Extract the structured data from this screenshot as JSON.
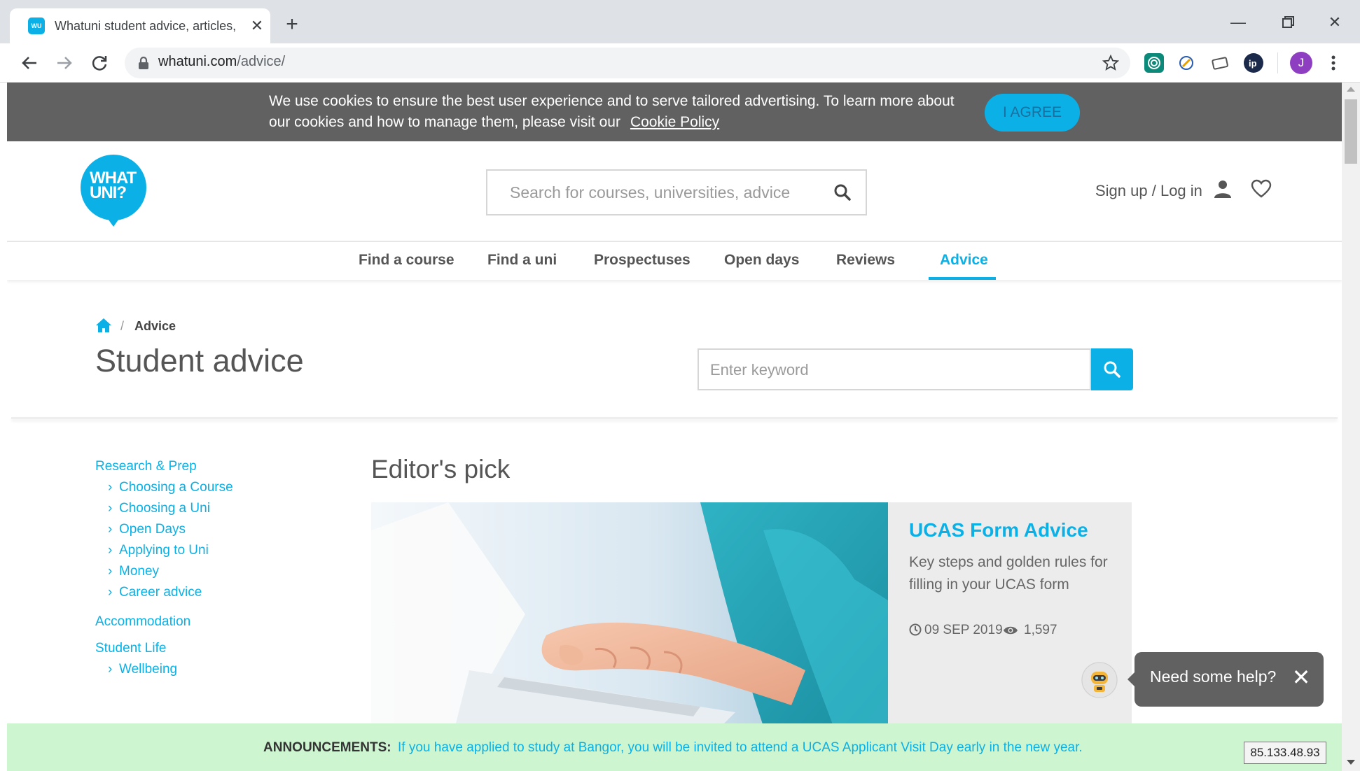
{
  "browser": {
    "tab_title": "Whatuni student advice, articles,",
    "tab_favicon": "WU",
    "url_host": "whatuni.com",
    "url_path": "/advice/",
    "profile_initial": "J"
  },
  "cookie": {
    "text": "We use cookies to ensure the best user experience and to serve tailored advertising. To learn more about our cookies and how to manage them, please visit our",
    "link": "Cookie Policy",
    "agree": "I AGREE"
  },
  "header": {
    "logo_line1": "WHAT",
    "logo_line2": "UNI?",
    "search_placeholder": "Search for courses, universities, advice",
    "signup": "Sign up / Log in"
  },
  "nav": {
    "items": [
      "Find a course",
      "Find a uni",
      "Prospectuses",
      "Open days",
      "Reviews",
      "Advice"
    ],
    "active": "Advice"
  },
  "hero": {
    "breadcrumb_sep": "/",
    "breadcrumb_current": "Advice",
    "title": "Student advice",
    "keyword_placeholder": "Enter keyword"
  },
  "sidebar": {
    "section1": "Research & Prep",
    "section1_items": [
      "Choosing a Course",
      "Choosing a Uni",
      "Open Days",
      "Applying to Uni",
      "Money",
      "Career advice"
    ],
    "section2": "Accommodation",
    "section3": "Student Life",
    "section3_items": [
      "Wellbeing"
    ]
  },
  "editors_pick": {
    "heading": "Editor's pick",
    "headline": "UCAS Form Advice",
    "description": "Key steps and golden rules for filling in your UCAS form",
    "date": "09 SEP 2019",
    "views": "1,597"
  },
  "help": {
    "text": "Need some help?"
  },
  "announcement": {
    "label": "ANNOUNCEMENTS:",
    "text": "If you have applied to study at Bangor, you will be invited to attend a UCAS Applicant Visit Day early in the new year."
  },
  "ip_address": "85.133.48.93",
  "colors": {
    "brand": "#0bb1e6",
    "cookie_bg": "#616161",
    "announce_bg": "#cdf5d0"
  }
}
